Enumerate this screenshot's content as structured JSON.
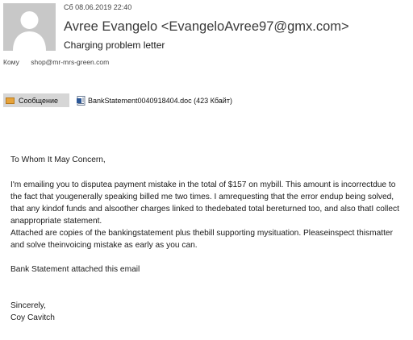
{
  "header": {
    "date": "Сб 08.06.2019 22:40",
    "sender": "Avree Evangelo <EvangeloAvree97@gmx.com>",
    "subject": "Charging problem letter",
    "to_label": "Кому",
    "to_value": "shop@mr-mrs-green.com"
  },
  "attachments": {
    "message_tab": "Сообщение",
    "file": "BankStatement0040918404.doc (423 Кбайт)"
  },
  "body": {
    "greeting": "To Whom It May Concern,",
    "paragraph1": "I'm emailing you to disputea payment mistake in the total of $157 on mybill. This amount is incorrectdue to the fact that yougenerally speaking billed me two times. I amrequesting that the error endup being solved, that any kindof funds and alsoother charges linked to thedebated total bereturned too, and also thatI collect anappropriate statement.",
    "paragraph2": "Attached are copies of the bankingstatement plus thebill supporting mysituation. Pleaseinspect thismatter and solve theinvoicing mistake as early as you can.",
    "paragraph3": "Bank Statement attached this email",
    "closing": "Sincerely,",
    "signature": "Coy Cavitch"
  },
  "icons": {
    "avatar": "person-silhouette-icon",
    "message": "envelope-icon",
    "attachment": "word-document-icon"
  },
  "colors": {
    "avatar_bg": "#c8c8c8",
    "tab_bg": "#d6d6d6",
    "envelope": "#e6a33a",
    "doc_blue": "#2b5797"
  }
}
